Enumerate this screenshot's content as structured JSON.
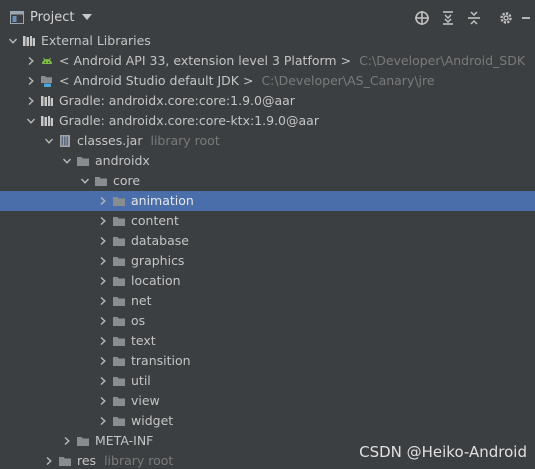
{
  "panel": {
    "title": "Project"
  },
  "tree": [
    {
      "label": "External Libraries",
      "hint": "",
      "level": 0,
      "expanded": true,
      "icon": "library-icon",
      "selected": false
    },
    {
      "label": "< Android API 33, extension level 3 Platform >",
      "hint": "C:\\Developer\\Android_SDK",
      "level": 1,
      "expanded": false,
      "icon": "android-icon",
      "selected": false
    },
    {
      "label": "< Android Studio default JDK >",
      "hint": "C:\\Developer\\AS_Canary\\jre",
      "level": 1,
      "expanded": false,
      "icon": "jdk-folder-icon",
      "selected": false
    },
    {
      "label": "Gradle: androidx.core:core:1.9.0@aar",
      "hint": "",
      "level": 1,
      "expanded": false,
      "icon": "gradle-library-icon",
      "selected": false
    },
    {
      "label": "Gradle: androidx.core:core-ktx:1.9.0@aar",
      "hint": "",
      "level": 1,
      "expanded": true,
      "icon": "gradle-library-icon",
      "selected": false
    },
    {
      "label": "classes.jar",
      "hint": "library root",
      "level": 2,
      "expanded": true,
      "icon": "jar-icon",
      "selected": false
    },
    {
      "label": "androidx",
      "hint": "",
      "level": 3,
      "expanded": true,
      "icon": "folder-icon",
      "selected": false
    },
    {
      "label": "core",
      "hint": "",
      "level": 4,
      "expanded": true,
      "icon": "folder-icon",
      "selected": false
    },
    {
      "label": "animation",
      "hint": "",
      "level": 5,
      "expanded": false,
      "icon": "folder-icon",
      "selected": true
    },
    {
      "label": "content",
      "hint": "",
      "level": 5,
      "expanded": false,
      "icon": "folder-icon",
      "selected": false
    },
    {
      "label": "database",
      "hint": "",
      "level": 5,
      "expanded": false,
      "icon": "folder-icon",
      "selected": false
    },
    {
      "label": "graphics",
      "hint": "",
      "level": 5,
      "expanded": false,
      "icon": "folder-icon",
      "selected": false
    },
    {
      "label": "location",
      "hint": "",
      "level": 5,
      "expanded": false,
      "icon": "folder-icon",
      "selected": false
    },
    {
      "label": "net",
      "hint": "",
      "level": 5,
      "expanded": false,
      "icon": "folder-icon",
      "selected": false
    },
    {
      "label": "os",
      "hint": "",
      "level": 5,
      "expanded": false,
      "icon": "folder-icon",
      "selected": false
    },
    {
      "label": "text",
      "hint": "",
      "level": 5,
      "expanded": false,
      "icon": "folder-icon",
      "selected": false
    },
    {
      "label": "transition",
      "hint": "",
      "level": 5,
      "expanded": false,
      "icon": "folder-icon",
      "selected": false
    },
    {
      "label": "util",
      "hint": "",
      "level": 5,
      "expanded": false,
      "icon": "folder-icon",
      "selected": false
    },
    {
      "label": "view",
      "hint": "",
      "level": 5,
      "expanded": false,
      "icon": "folder-icon",
      "selected": false
    },
    {
      "label": "widget",
      "hint": "",
      "level": 5,
      "expanded": false,
      "icon": "folder-icon",
      "selected": false
    },
    {
      "label": "META-INF",
      "hint": "",
      "level": 3,
      "expanded": false,
      "icon": "folder-icon",
      "selected": false
    },
    {
      "label": "res",
      "hint": "library root",
      "level": 2,
      "expanded": false,
      "icon": "folder-icon",
      "selected": false
    }
  ],
  "watermark": "CSDN @Heiko-Android",
  "colors": {
    "background": "#3c3f41",
    "selection": "#4a6ea9",
    "folder": "#8a8d90",
    "android": "#7fc242",
    "hint": "#7a7a7a"
  }
}
